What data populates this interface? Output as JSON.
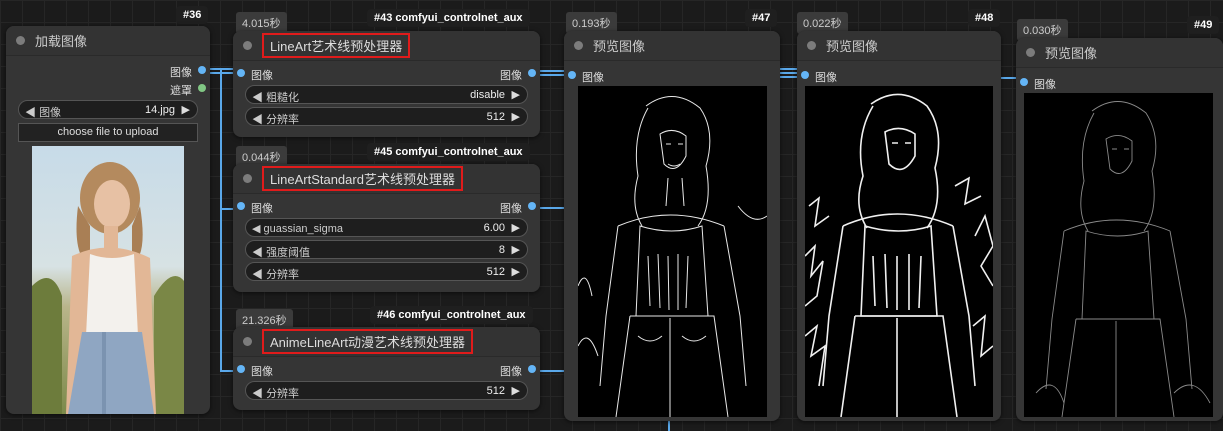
{
  "colors": {
    "image_port": "#64b5f6",
    "mask_port": "#81c784",
    "wire": "#5aa8ea",
    "highlight": "#e01b1b"
  },
  "load_node": {
    "id": "#36",
    "title": "加载图像",
    "outputs": [
      "图像",
      "遮罩"
    ],
    "image_widget": {
      "label": "图像",
      "value": "14.jpg"
    },
    "upload_label": "choose file to upload"
  },
  "node43": {
    "id": "#43 comfyui_controlnet_aux",
    "time": "4.015秒",
    "title": "LineArt艺术线预处理器",
    "in_label": "图像",
    "out_label": "图像",
    "widgets": [
      {
        "label": "粗糙化",
        "value": "disable"
      },
      {
        "label": "分辨率",
        "value": "512"
      }
    ]
  },
  "node45": {
    "id": "#45 comfyui_controlnet_aux",
    "time": "0.044秒",
    "title": "LineArtStandard艺术线预处理器",
    "in_label": "图像",
    "out_label": "图像",
    "widgets": [
      {
        "label": "guassian_sigma",
        "value": "6.00"
      },
      {
        "label": "强度阈值",
        "value": "8"
      },
      {
        "label": "分辨率",
        "value": "512"
      }
    ]
  },
  "node46": {
    "id": "#46 comfyui_controlnet_aux",
    "time": "21.326秒",
    "title": "AnimeLineArt动漫艺术线预处理器",
    "in_label": "图像",
    "out_label": "图像",
    "widgets": [
      {
        "label": "分辨率",
        "value": "512"
      }
    ]
  },
  "preview_nodes": [
    {
      "id": "#47",
      "time": "0.193秒",
      "title": "预览图像",
      "in_label": "图像"
    },
    {
      "id": "#48",
      "time": "0.022秒",
      "title": "预览图像",
      "in_label": "图像"
    },
    {
      "id": "#49",
      "time": "0.030秒",
      "title": "预览图像",
      "in_label": "图像"
    }
  ]
}
